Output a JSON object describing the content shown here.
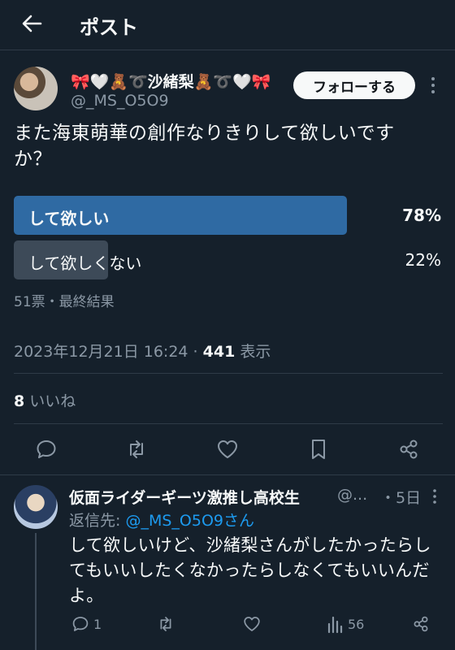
{
  "header": {
    "title": "ポスト"
  },
  "tweet": {
    "display_name": "🎀🤍🧸➰沙緒梨🧸➰🤍🎀",
    "handle": "@_MS_O5O9",
    "follow_label": "フォローする",
    "text_line1": "また海東萌華の創作なりきりして欲しいです",
    "text_line2": "か？",
    "poll": {
      "options": [
        {
          "label": "して欲しい",
          "percent": "78%",
          "value": 78
        },
        {
          "label": "して欲しくない",
          "percent": "22%",
          "value": 22
        }
      ],
      "meta": "51票・最終結果"
    },
    "timestamp": "2023年12月21日 16:24 · ",
    "views_count": "441",
    "views_label": " 表示",
    "likes_count": "8",
    "likes_label": " いいね"
  },
  "reply": {
    "display_name": "仮面ライダーギーツ激推し高校生",
    "handle": "@...",
    "date": "・5日",
    "reply_to_prefix": "返信先: ",
    "reply_to_handle": "@_MS_O5O9さん",
    "text": "して欲しいけど、沙緒梨さんがしたかったらしてもいいしたくなかったらしなくてもいいんだよ。",
    "replies_count": "1",
    "views_count": "56"
  },
  "colors": {
    "background": "#15202b",
    "winning_bar": "#2f6aa3",
    "losing_bar": "#3d4a58",
    "link": "#1d9bf0"
  }
}
